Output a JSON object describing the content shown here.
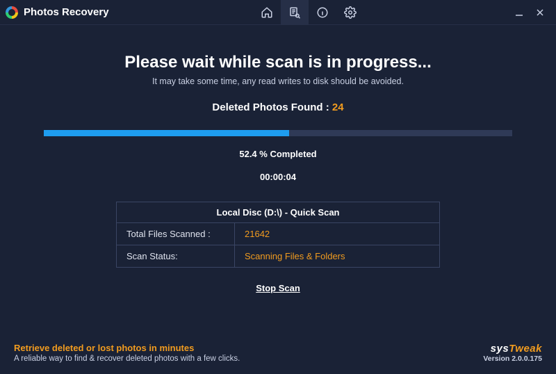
{
  "app_title": "Photos Recovery",
  "header": {
    "heading": "Please wait while scan is in progress...",
    "subtext": "It may take some time, any read writes to disk should be avoided."
  },
  "found": {
    "label": "Deleted Photos Found :",
    "count": "24"
  },
  "progress": {
    "percent_text": "52.4 % Completed",
    "percent_value": 52.4,
    "elapsed": "00:00:04"
  },
  "panel": {
    "title": "Local Disc (D:\\) - Quick Scan",
    "rows": [
      {
        "label": "Total Files Scanned :",
        "value": "21642"
      },
      {
        "label": "Scan Status:",
        "value": "Scanning Files & Folders"
      }
    ]
  },
  "stop_label": "Stop Scan",
  "footer": {
    "tagline": "Retrieve deleted or lost photos in minutes",
    "tagdesc": "A reliable way to find & recover deleted photos with a few clicks.",
    "brand_a": "sys",
    "brand_b": "Tweak",
    "version": "Version 2.0.0.175"
  }
}
